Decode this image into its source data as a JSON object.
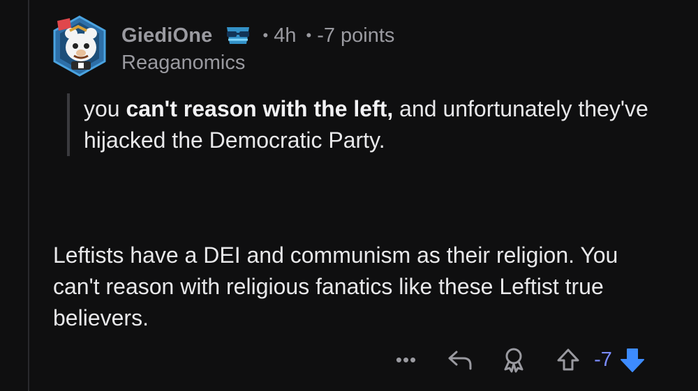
{
  "comment": {
    "author": "GiediOne",
    "time": "4h",
    "points": "-7 points",
    "flair": "Reaganomics",
    "separator": "•",
    "quote": {
      "before": "you ",
      "bold": "can't reason with the left,",
      "after": " and unfortunately they've hijacked the Democratic Party."
    },
    "body": "Leftists have a DEI and communism as their religion.  You can't reason with religious fanatics like these Leftist true believers."
  },
  "actions": {
    "more_label": "•••",
    "score": "-7"
  },
  "colors": {
    "background": "#0f0f10",
    "text": "#e8e8ea",
    "muted": "#9a9aa0",
    "vote_accent": "#7b8cff",
    "downvote_active": "#3d8bff"
  },
  "icons": {
    "avatar": "snoo-avatar",
    "badge": "sunglasses-badge-icon",
    "reply": "reply-icon",
    "award": "award-icon",
    "upvote": "upvote-arrow-icon",
    "downvote": "downvote-arrow-icon"
  }
}
